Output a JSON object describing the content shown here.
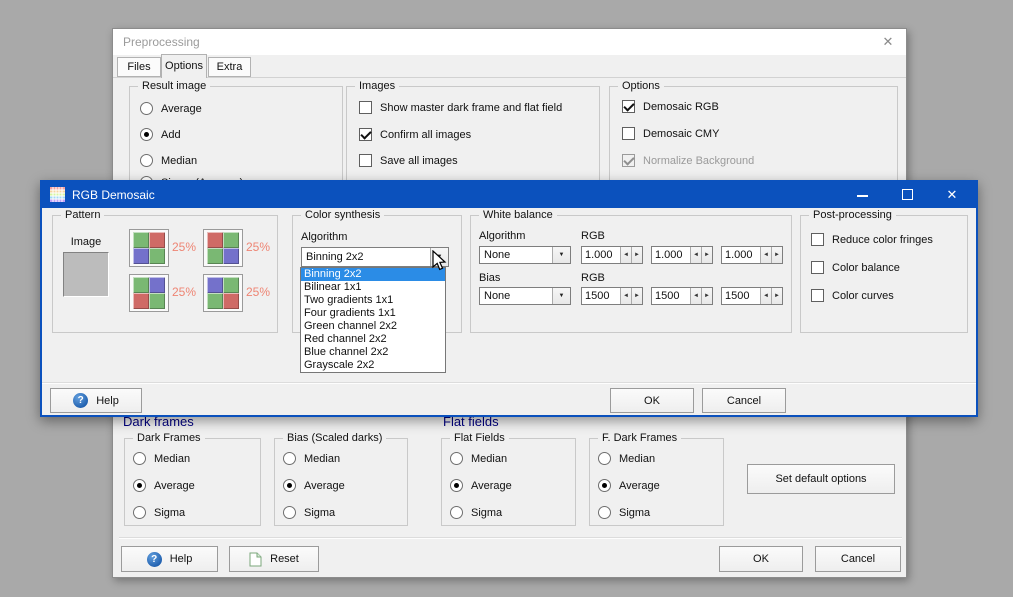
{
  "colors": {
    "desktop_bg": "#a9a9a9",
    "titlebar_blue": "#0b51bd",
    "list_highlight": "#2b8ce6",
    "percent_color": "#ee8574",
    "pattern_green": "#7ab873",
    "pattern_red": "#cf6a66",
    "pattern_blue": "#7471cb",
    "section_header": "#000080"
  },
  "icons": {
    "close": "✕",
    "help": "?",
    "dropdown": "▼",
    "spin_left": "◄",
    "spin_right": "►"
  },
  "preprocessing": {
    "title": "Preprocessing",
    "tabs": [
      {
        "label": "Files",
        "selected": false
      },
      {
        "label": "Options",
        "selected": true
      },
      {
        "label": "Extra",
        "selected": false
      }
    ],
    "result_image": {
      "title": "Result image",
      "options": [
        {
          "label": "Average",
          "selected": false
        },
        {
          "label": "Add",
          "selected": true
        },
        {
          "label": "Median",
          "selected": false
        },
        {
          "label": "Sigma (Average)",
          "selected": false
        }
      ]
    },
    "images": {
      "title": "Images",
      "options": [
        {
          "label": "Show master dark frame and flat field",
          "checked": false
        },
        {
          "label": "Confirm all images",
          "checked": true
        },
        {
          "label": "Save all images",
          "checked": false
        }
      ]
    },
    "options": {
      "title": "Options",
      "options": [
        {
          "label": "Demosaic RGB",
          "checked": true,
          "disabled": false
        },
        {
          "label": "Demosaic CMY",
          "checked": false,
          "disabled": false
        },
        {
          "label": "Normalize Background",
          "checked": true,
          "disabled": true
        }
      ]
    },
    "dark_frames_header": "Dark frames",
    "flat_fields_header": "Flat fields",
    "dark_frames": {
      "title": "Dark Frames",
      "options": [
        {
          "label": "Median",
          "selected": false
        },
        {
          "label": "Average",
          "selected": true
        },
        {
          "label": "Sigma",
          "selected": false
        }
      ]
    },
    "bias_scaled": {
      "title": "Bias (Scaled darks)",
      "options": [
        {
          "label": "Median",
          "selected": false
        },
        {
          "label": "Average",
          "selected": true
        },
        {
          "label": "Sigma",
          "selected": false
        }
      ]
    },
    "flat_fields": {
      "title": "Flat Fields",
      "options": [
        {
          "label": "Median",
          "selected": false
        },
        {
          "label": "Average",
          "selected": true
        },
        {
          "label": "Sigma",
          "selected": false
        }
      ]
    },
    "f_dark_frames": {
      "title": "F. Dark Frames",
      "options": [
        {
          "label": "Median",
          "selected": false
        },
        {
          "label": "Average",
          "selected": true
        },
        {
          "label": "Sigma",
          "selected": false
        }
      ]
    },
    "set_default_label": "Set default options",
    "footer": {
      "help": "Help",
      "reset": "Reset",
      "ok": "OK",
      "cancel": "Cancel"
    }
  },
  "rgb_demosaic": {
    "title": "RGB Demosaic",
    "pattern": {
      "title": "Pattern",
      "image_label": "Image",
      "buttons": [
        {
          "percent": "25%",
          "cells": [
            "green",
            "red",
            "blue",
            "green"
          ]
        },
        {
          "percent": "25%",
          "cells": [
            "red",
            "green",
            "green",
            "blue"
          ]
        },
        {
          "percent": "25%",
          "cells": [
            "green",
            "blue",
            "red",
            "green"
          ]
        },
        {
          "percent": "25%",
          "cells": [
            "blue",
            "green",
            "green",
            "red"
          ]
        }
      ]
    },
    "color_synthesis": {
      "title": "Color synthesis",
      "algorithm_label": "Algorithm",
      "value": "Binning 2x2",
      "items": [
        {
          "label": "Binning 2x2",
          "highlighted": true
        },
        {
          "label": "Bilinear 1x1",
          "highlighted": false
        },
        {
          "label": "Two gradients 1x1",
          "highlighted": false
        },
        {
          "label": "Four gradients 1x1",
          "highlighted": false
        },
        {
          "label": "Green channel 2x2",
          "highlighted": false
        },
        {
          "label": "Red channel 2x2",
          "highlighted": false
        },
        {
          "label": "Blue channel 2x2",
          "highlighted": false
        },
        {
          "label": "Grayscale 2x2",
          "highlighted": false
        }
      ]
    },
    "white_balance": {
      "title": "White balance",
      "algorithm_label": "Algorithm",
      "algorithm_value": "None",
      "rgb_label": "RGB",
      "rgb_values": [
        "1.000",
        "1.000",
        "1.000"
      ],
      "bias_label": "Bias",
      "bias_value": "None",
      "bias_rgb_label": "RGB",
      "bias_values": [
        "1500",
        "1500",
        "1500"
      ]
    },
    "post_processing": {
      "title": "Post-processing",
      "options": [
        {
          "label": "Reduce color fringes",
          "checked": false
        },
        {
          "label": "Color balance",
          "checked": false
        },
        {
          "label": "Color curves",
          "checked": false
        }
      ]
    },
    "footer": {
      "help": "Help",
      "ok": "OK",
      "cancel": "Cancel"
    }
  }
}
